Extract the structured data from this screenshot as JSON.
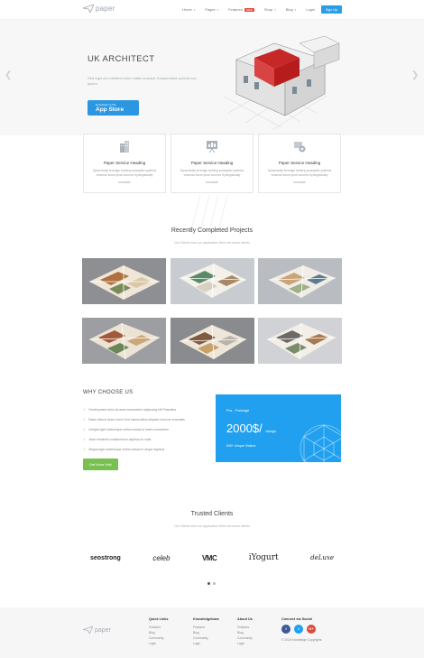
{
  "header": {
    "logo_text": "paper",
    "nav": [
      {
        "label": "Home",
        "has_chevron": true
      },
      {
        "label": "Pages",
        "has_chevron": true
      },
      {
        "label": "Features",
        "badge": "NEW",
        "has_chevron": false
      },
      {
        "label": "Shop",
        "has_chevron": true
      },
      {
        "label": "Blog",
        "has_chevron": true
      },
      {
        "label": "Login",
        "has_chevron": false
      }
    ],
    "signup_label": "Sign Up"
  },
  "hero": {
    "title": "UK ARCHITECT",
    "subtitle": "Sed eget orci eleifend enim mattis suscipit. Suspendisse potenti non ipsum.",
    "appstore_small": "Download on the",
    "appstore_big": "App Store"
  },
  "services": [
    {
      "icon": "building-icon",
      "title": "Paper Service Heading",
      "text": "Dynamically leverage existing synergistic systems whereas future-proof sources Synergistically",
      "link": "formulate"
    },
    {
      "icon": "presentation-icon",
      "title": "Paper Service Heading",
      "text": "Dynamically leverage existing synergistic systems whereas future-proof sources Synergistically",
      "link": "formulate"
    },
    {
      "icon": "gear-icon",
      "title": "Paper Service Heading",
      "text": "Dynamically leverage existing synergistic systems whereas future-proof sources Synergistically",
      "link": "formulate"
    }
  ],
  "projects": {
    "title": "Recently Completed Projects",
    "subtitle": "Our Clients love our application Here are some clients",
    "tiles": [
      "floorplan-3d",
      "floorplan-3d",
      "floorplan-3d",
      "floorplan-3d",
      "floorplan-3d",
      "floorplan-3d"
    ]
  },
  "why": {
    "title": "WHY CHOOSE US",
    "items": [
      "Development dolor sit amet consectetur adipiscing elit Phasellus",
      "Etiam dictum lorem lorem Sed massa tellus aliquam rhoncus venenatis",
      "Integral eget scelerisque metus massa id amet consectetur",
      "Vitae hendrerit condimentum dapibus eu nulla",
      "Magna eget scelerisque metus massa in neque dapibus"
    ],
    "button_label": "Get More Info!"
  },
  "package": {
    "label": "Pro - Package",
    "price": "2000$/",
    "unit": "design",
    "visits": "500+ Unique Visitors"
  },
  "clients": {
    "title": "Trusted Clients",
    "subtitle": "Our Clients love our application Here are some clients",
    "logos": [
      "seostrong",
      "celeb",
      "VMC",
      "iYogurt",
      "deLuxe"
    ]
  },
  "footer": {
    "logo_text": "paper",
    "columns": [
      {
        "title": "Quick Links",
        "items": [
          "Features",
          "Blog",
          "Community",
          "Login"
        ]
      },
      {
        "title": "Knowledgebase",
        "items": [
          "Features",
          "Blog",
          "Community",
          "Login"
        ]
      },
      {
        "title": "About Us",
        "items": [
          "Features",
          "Blog",
          "Community",
          "Login"
        ]
      }
    ],
    "social_title": "Connect via Social",
    "social": [
      {
        "name": "facebook",
        "glyph": "f",
        "color": "#3b5998"
      },
      {
        "name": "twitter",
        "glyph": "t",
        "color": "#1da1f2"
      },
      {
        "name": "google-plus",
        "glyph": "G+",
        "color": "#dd4b39"
      }
    ],
    "copyright": "© 2016 Knowledge Copyrights"
  }
}
